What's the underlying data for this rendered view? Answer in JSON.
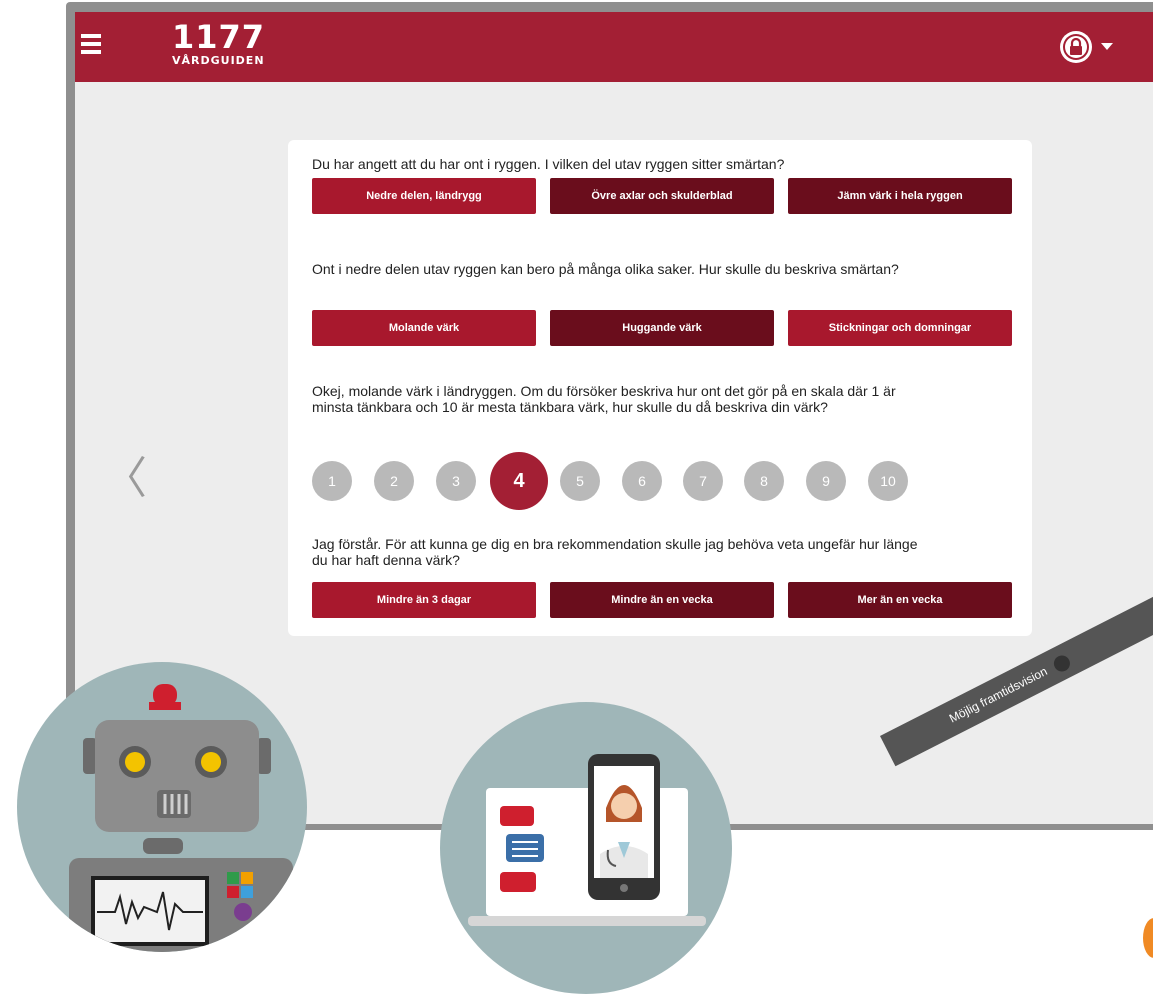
{
  "header": {
    "logo_number": "1177",
    "logo_brand": "VÅRDGUIDEN",
    "menu_icon": "hamburger-icon",
    "account_icon": "lock-icon"
  },
  "questions": [
    {
      "text": "Du har angett att du har ont i ryggen. I vilken del utav ryggen sitter smärtan?",
      "options": [
        "Nedre delen, ländrygg",
        "Övre axlar och skulderblad",
        "Jämn värk i hela ryggen"
      ]
    },
    {
      "text": "Ont i nedre delen utav ryggen kan bero på många olika saker. Hur skulle du beskriva smärtan?",
      "options": [
        "Molande värk",
        "Huggande värk",
        "Stickningar och domningar"
      ]
    },
    {
      "text": "Okej, molande värk i ländryggen. Om du försöker beskriva hur ont det gör på en skala där 1 är minsta tänkbara och 10 är mesta tänkbara värk, hur skulle du då beskriva din värk?",
      "scale": [
        "1",
        "2",
        "3",
        "4",
        "5",
        "6",
        "7",
        "8",
        "9",
        "10"
      ],
      "selected": "4"
    },
    {
      "text": "Jag förstår. För att kunna ge dig en bra rekommendation skulle jag behöva veta ungefär hur länge du har haft denna värk?",
      "options": [
        "Mindre än 3 dagar",
        "Mindre än en vecka",
        "Mer än en vecka"
      ]
    }
  ],
  "ribbon": {
    "label": "Möjlig framtidsvision",
    "icon": "info-icon"
  },
  "colors": {
    "brand": "#a31f34",
    "option_light": "#a8182d",
    "option_dark": "#6a0d1c",
    "scale_inactive": "#b9b9b9",
    "circle_bg": "#9fb6b8"
  },
  "illustrations": [
    "robot-icon",
    "doctor-video-chat-icon"
  ]
}
